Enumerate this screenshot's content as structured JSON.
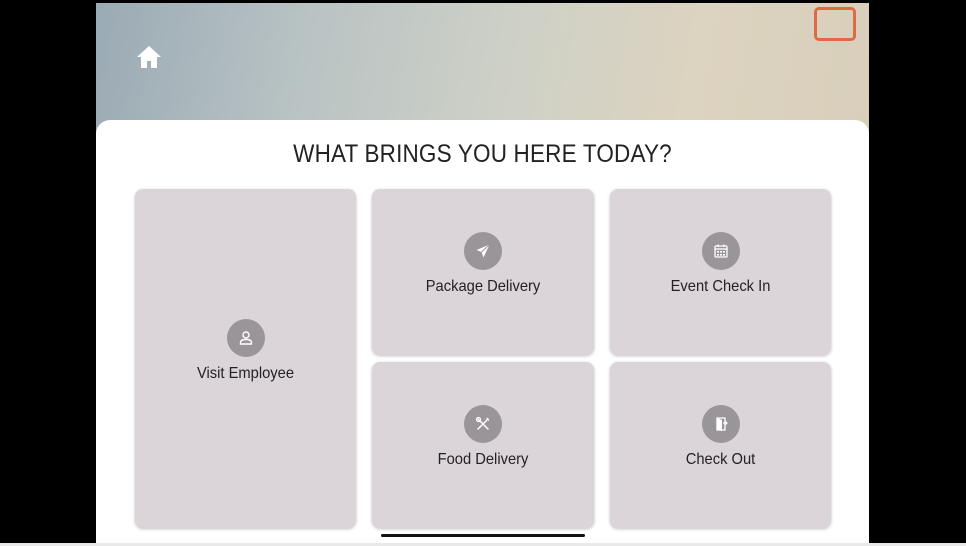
{
  "header": {
    "home_icon": "home-icon"
  },
  "main": {
    "title": "WHAT BRINGS YOU HERE TODAY?",
    "options": [
      {
        "label": "Visit Employee",
        "icon": "person-icon"
      },
      {
        "label": "Package Delivery",
        "icon": "paper-plane-icon"
      },
      {
        "label": "Event Check In",
        "icon": "calendar-icon"
      },
      {
        "label": "Food Delivery",
        "icon": "utensils-icon"
      },
      {
        "label": "Check Out",
        "icon": "door-exit-icon"
      }
    ]
  },
  "colors": {
    "tile_bg": "#dbd4d9",
    "icon_circle": "#9a9598",
    "highlight": "#e06a44"
  }
}
